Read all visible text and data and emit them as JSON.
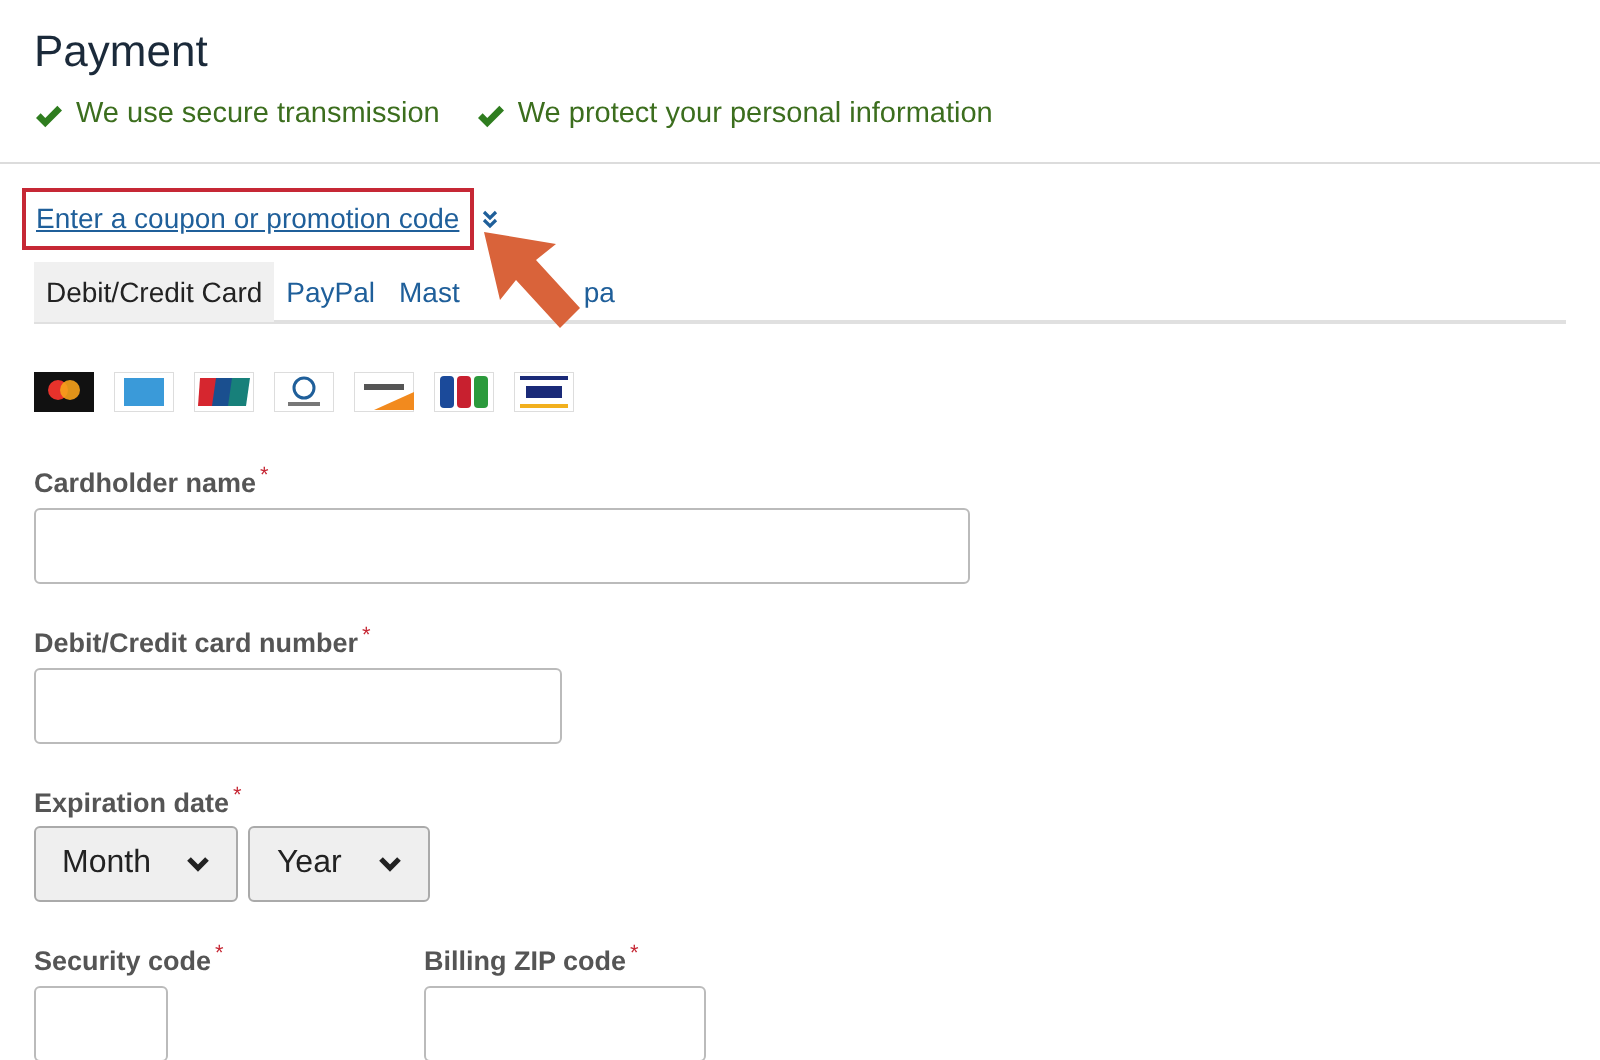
{
  "title": "Payment",
  "assurances": [
    "We use secure transmission",
    "We protect your personal information"
  ],
  "coupon_link": {
    "label": "Enter a coupon or promotion code",
    "highlighted": true,
    "expanded": false
  },
  "tabs": [
    {
      "label": "Debit/Credit Card",
      "selected": true
    },
    {
      "label": "PayPal",
      "selected": false
    },
    {
      "label": "Mast",
      "label_after_arrow": "pa",
      "selected": false
    }
  ],
  "card_logos": [
    {
      "kind": "mastercard"
    },
    {
      "kind": "amex"
    },
    {
      "kind": "unionpay"
    },
    {
      "kind": "diners"
    },
    {
      "kind": "discover"
    },
    {
      "kind": "jcb"
    },
    {
      "kind": "visa"
    }
  ],
  "fields": [
    {
      "kind": "text",
      "label": "Cardholder name",
      "required_mark": "*"
    },
    {
      "kind": "text",
      "label": "Debit/Credit card number",
      "required_mark": "*"
    },
    {
      "kind": "selects",
      "label": "Expiration date",
      "required_mark": "*",
      "options": [
        "Month",
        "Year"
      ]
    },
    {
      "kind": "pair",
      "items": [
        {
          "label": "Security code",
          "required_mark": "*"
        },
        {
          "label": "Billing ZIP code",
          "required_mark": "*"
        }
      ]
    }
  ]
}
